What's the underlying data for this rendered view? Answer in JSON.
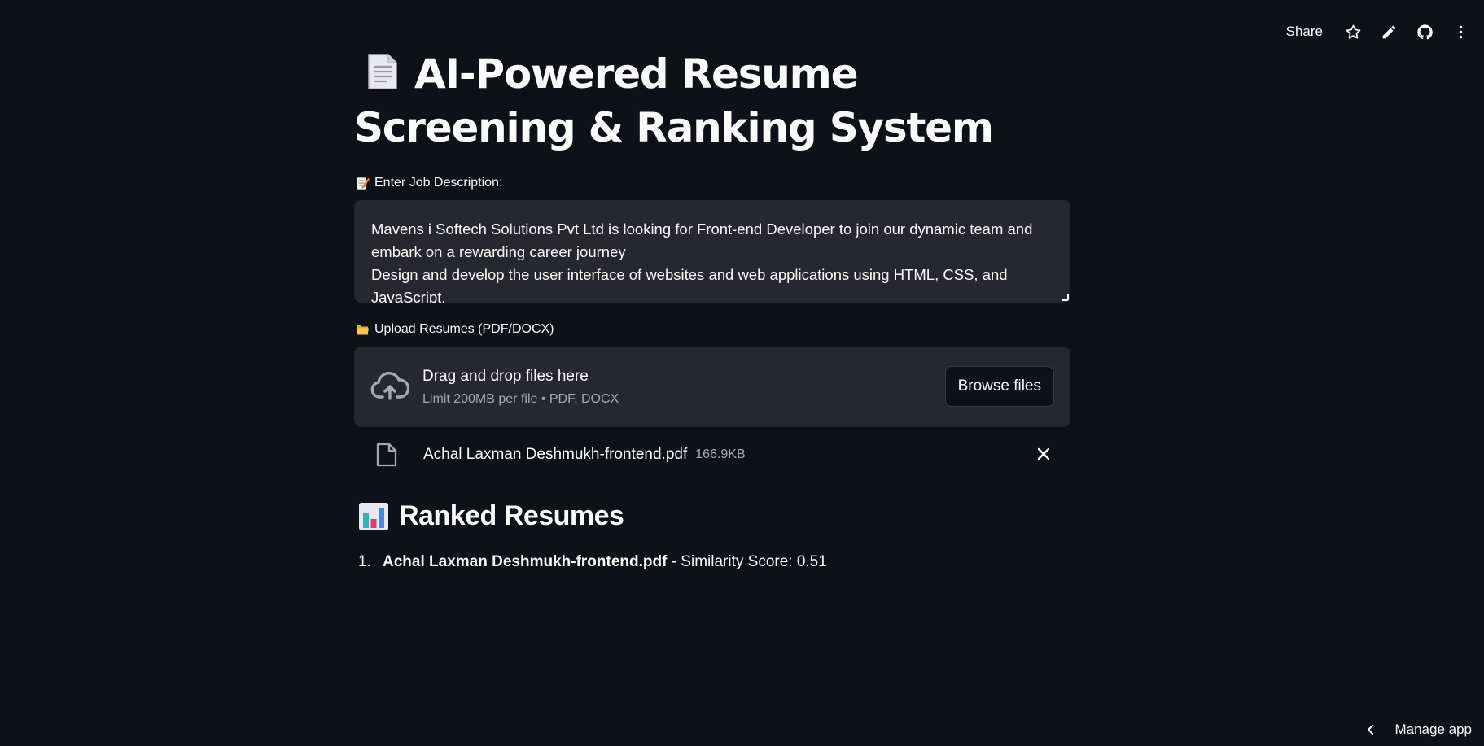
{
  "toolbar": {
    "share_label": "Share",
    "icons": [
      "star-icon",
      "pencil-icon",
      "github-icon",
      "more-vertical-icon"
    ]
  },
  "page": {
    "title": "AI-Powered Resume Screening & Ranking System",
    "title_icon": "document-emoji"
  },
  "job_description": {
    "label": "Enter Job Description:",
    "label_icon": "memo-emoji",
    "lines": [
      "Mavens i Softech Solutions Pvt Ltd is looking for Front-end Developer to join our dynamic team and",
      "embark on a rewarding career journey",
      "Design and develop the user interface of websites and web applications using HTML, CSS, and",
      "JavaScript."
    ]
  },
  "uploader": {
    "label": "Upload Resumes (PDF/DOCX)",
    "label_icon": "folder-emoji",
    "drag_text": "Drag and drop files here",
    "limit_text": "Limit 200MB per file • PDF, DOCX",
    "browse_label": "Browse files"
  },
  "uploaded_file": {
    "name": "Achal Laxman Deshmukh-frontend.pdf",
    "size": "166.9KB"
  },
  "results": {
    "heading": "Ranked Resumes",
    "heading_icon": "bar-chart-emoji",
    "items": [
      {
        "number": "1.",
        "name": "Achal Laxman Deshmukh-frontend.pdf",
        "suffix": " - Similarity Score: 0.51"
      }
    ]
  },
  "footer": {
    "manage_label": "Manage app"
  }
}
